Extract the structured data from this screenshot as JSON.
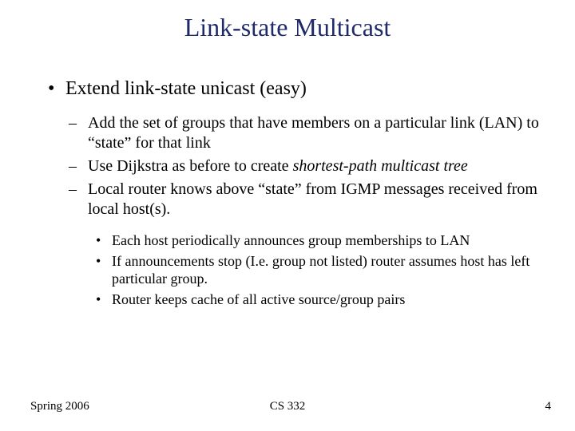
{
  "title": "Link-state Multicast",
  "bullets": {
    "b1": "Extend link-state unicast (easy)",
    "b1a_pre": "Add the set of groups that have members on a particular link (LAN) to “state” for that link",
    "b1b_pre": "Use Dijkstra as before to create ",
    "b1b_em": "shortest-path multicast tree",
    "b1c": "Local router knows above “state” from IGMP messages received from local host(s).",
    "b1c1": "Each host periodically announces group memberships to LAN",
    "b1c2": "If announcements stop (I.e. group not listed) router assumes host has left particular group.",
    "b1c3": "Router keeps cache of all active source/group pairs"
  },
  "footer": {
    "left": "Spring 2006",
    "center": "CS 332",
    "right": "4"
  }
}
